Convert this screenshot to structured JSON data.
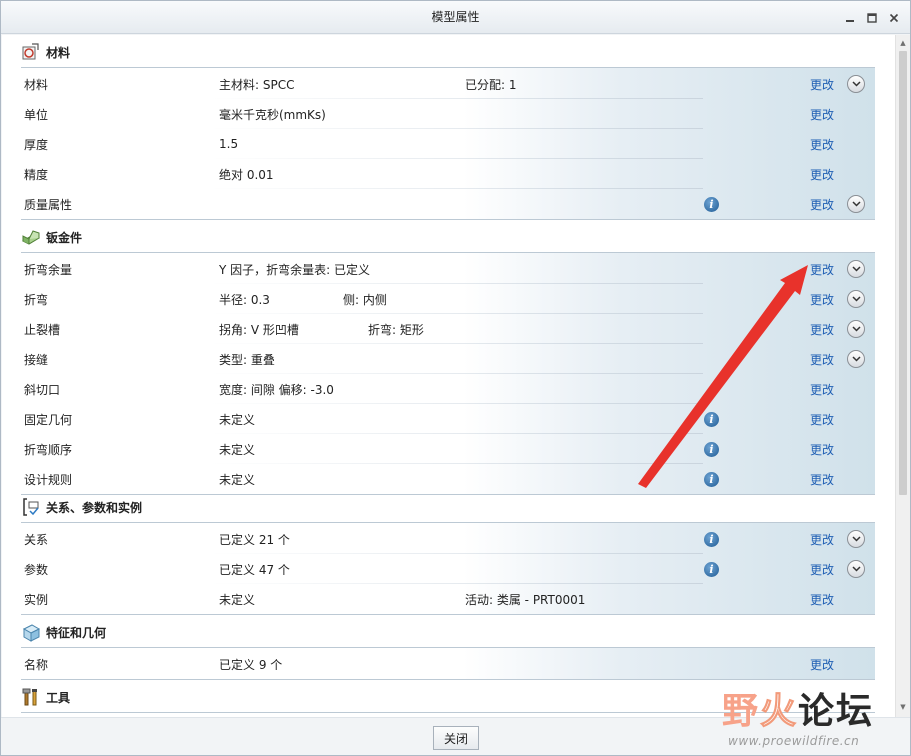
{
  "window": {
    "title": "模型属性",
    "buttons": [
      "minimize",
      "maximize",
      "close"
    ]
  },
  "sections": [
    {
      "title": "材料",
      "icon": "material-icon",
      "rows": [
        {
          "label": "材料",
          "value": "主材料: SPCC",
          "value2": "已分配: 1",
          "info": false,
          "change": "更改",
          "expand": true
        },
        {
          "label": "单位",
          "value": "毫米千克秒(mmKs)",
          "value2": "",
          "info": false,
          "change": "更改",
          "expand": false
        },
        {
          "label": "厚度",
          "value": "1.5",
          "value2": "",
          "info": false,
          "change": "更改",
          "expand": false
        },
        {
          "label": "精度",
          "value": "绝对 0.01",
          "value2": "",
          "info": false,
          "change": "更改",
          "expand": false
        },
        {
          "label": "质量属性",
          "value": "",
          "value2": "",
          "info": true,
          "change": "更改",
          "expand": true
        }
      ]
    },
    {
      "title": "钣金件",
      "icon": "sheetmetal-icon",
      "rows": [
        {
          "label": "折弯余量",
          "value": "Y 因子，折弯余量表: 已定义",
          "value2": "",
          "info": false,
          "change": "更改",
          "expand": true
        },
        {
          "label": "折弯",
          "value": "半径: 0.3",
          "value2": "侧: 内侧",
          "info": false,
          "change": "更改",
          "expand": true
        },
        {
          "label": "止裂槽",
          "value": "拐角: V 形凹槽",
          "value2": "折弯: 矩形",
          "info": false,
          "change": "更改",
          "expand": true
        },
        {
          "label": "接缝",
          "value": "类型: 重叠",
          "value2": "",
          "info": false,
          "change": "更改",
          "expand": true
        },
        {
          "label": "斜切口",
          "value": "宽度: 间隙 偏移: -3.0",
          "value2": "",
          "info": false,
          "change": "更改",
          "expand": false
        },
        {
          "label": "固定几何",
          "value": "未定义",
          "value2": "",
          "info": true,
          "change": "更改",
          "expand": false
        },
        {
          "label": "折弯顺序",
          "value": "未定义",
          "value2": "",
          "info": true,
          "change": "更改",
          "expand": false
        },
        {
          "label": "设计规则",
          "value": "未定义",
          "value2": "",
          "info": true,
          "change": "更改",
          "expand": false
        }
      ]
    },
    {
      "title": "关系、参数和实例",
      "icon": "relations-icon",
      "rows": [
        {
          "label": "关系",
          "value": "已定义 21 个",
          "value2": "",
          "info": true,
          "change": "更改",
          "expand": true
        },
        {
          "label": "参数",
          "value": "已定义 47 个",
          "value2": "",
          "info": true,
          "change": "更改",
          "expand": true
        },
        {
          "label": "实例",
          "value": "未定义",
          "value2": "活动: 类属 - PRT0001",
          "info": false,
          "change": "更改",
          "expand": false
        }
      ]
    },
    {
      "title": "特征和几何",
      "icon": "features-icon",
      "rows": [
        {
          "label": "名称",
          "value": "已定义 9 个",
          "value2": "",
          "info": false,
          "change": "更改",
          "expand": false
        }
      ]
    },
    {
      "title": "工具",
      "icon": "tools-icon",
      "rows": []
    }
  ],
  "footer": {
    "close_label": "关闭"
  },
  "watermark": {
    "text_part1": "野",
    "text_part2": "火",
    "text_part3": "论坛",
    "url": "www.proewildfire.cn"
  },
  "annotation": {
    "arrow_color": "#e8322b"
  },
  "colors": {
    "link": "#1f5fb4",
    "panel_gradient_end": "#d0e1ea"
  }
}
